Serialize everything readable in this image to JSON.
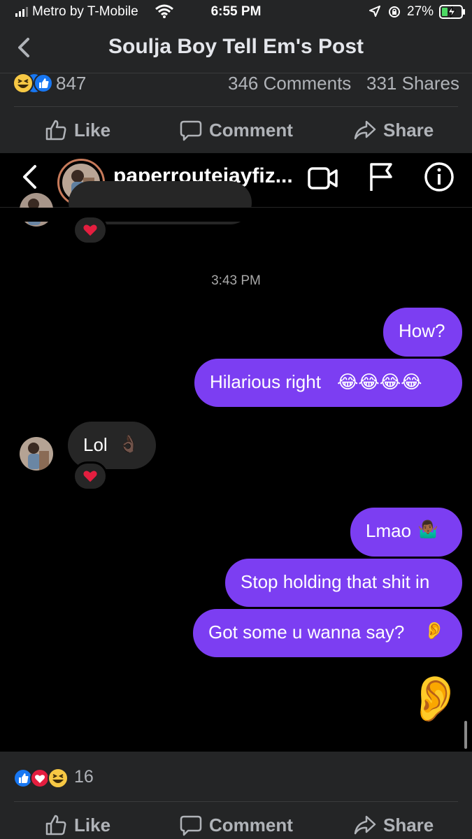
{
  "status_bar": {
    "carrier": "Metro by T-Mobile",
    "time": "6:55 PM",
    "battery": "27%"
  },
  "header": {
    "title": "Soulja Boy Tell Em's Post"
  },
  "stats_top": {
    "reactions": "847",
    "comments": "346 Comments",
    "shares": "331 Shares"
  },
  "actions": {
    "like": "Like",
    "comment": "Comment",
    "share": "Share"
  },
  "dm": {
    "username": "paperroutejayfiz...",
    "timestamp": "3:43 PM",
    "messages": [
      {
        "text": "How?"
      },
      {
        "text": "Hilarious right"
      },
      {
        "text": "Lol"
      },
      {
        "text": "Lmao"
      },
      {
        "text": "Stop holding that shit in"
      },
      {
        "text": "Got some u wanna say?"
      }
    ]
  },
  "stats_bottom": {
    "reactions": "16"
  },
  "colors": {
    "sent_bubble": "#7c3ef2",
    "received_bubble": "#262626",
    "fb_blue": "#1877f2",
    "heart_red": "#e41e3f"
  }
}
